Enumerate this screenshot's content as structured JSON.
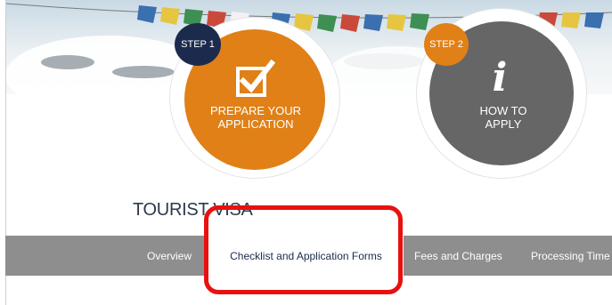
{
  "steps": [
    {
      "badge": "STEP 1",
      "label_line1": "PREPARE YOUR",
      "label_line2": "APPLICATION",
      "icon": "checkbox-icon",
      "color": "#e08017"
    },
    {
      "badge": "STEP 2",
      "label_line1": "HOW TO",
      "label_line2": "APPLY",
      "icon": "info-icon",
      "icon_glyph": "i",
      "color": "#666666"
    }
  ],
  "page_title": "TOURIST VISA",
  "tabs": [
    {
      "label": "Overview",
      "active": false
    },
    {
      "label": "Checklist and Application Forms",
      "active": true
    },
    {
      "label": "Fees and Charges",
      "active": false
    },
    {
      "label": "Processing Time",
      "active": false
    }
  ],
  "colors": {
    "accent_orange": "#e08017",
    "navy": "#1c2b4d",
    "tab_bar": "#8e8e8e",
    "highlight_red": "#e8110f"
  }
}
